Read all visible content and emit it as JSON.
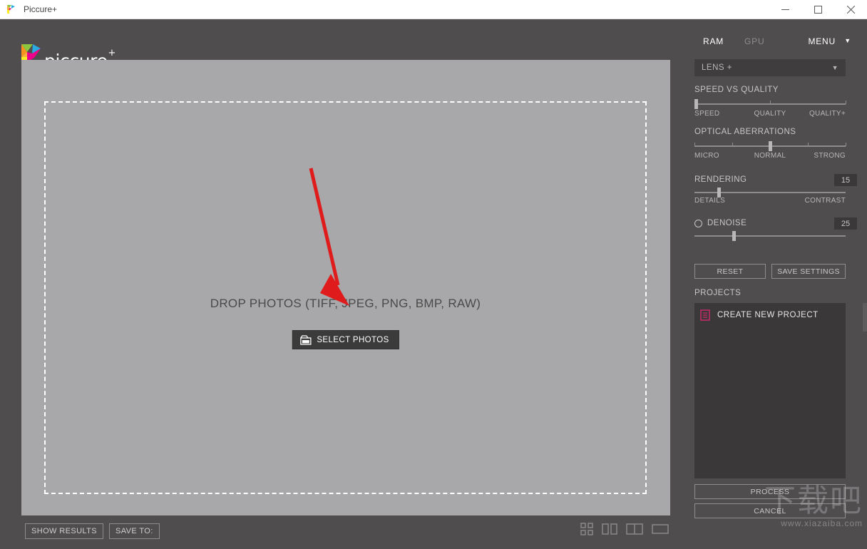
{
  "window": {
    "title": "Piccure+",
    "app_icon": "piccure-logo-icon",
    "controls": {
      "minimize": "minimize-icon",
      "maximize": "maximize-icon",
      "close": "close-icon"
    }
  },
  "brand": {
    "name": "piccure",
    "superscript": "+",
    "mark": "piccure-p-logo"
  },
  "canvas": {
    "drop_text": "DROP PHOTOS (TIFF, JPEG, PNG, BMP, RAW)",
    "select_button": "SELECT PHOTOS",
    "select_button_icon": "photo-folder-icon",
    "background_color": "#a8a8aa"
  },
  "annotation": {
    "type": "red-arrow",
    "color": "#e01b1b"
  },
  "bottom_bar": {
    "show_results": "SHOW RESULTS",
    "save_to": "SAVE TO:",
    "view_modes": [
      {
        "name": "grid-view-icon",
        "label": "grid"
      },
      {
        "name": "two-pane-view-icon",
        "label": "two-pane"
      },
      {
        "name": "split-view-icon",
        "label": "split"
      },
      {
        "name": "single-view-icon",
        "label": "single"
      }
    ]
  },
  "sidebar": {
    "top": {
      "ram": "RAM",
      "gpu": "GPU",
      "menu": "MENU",
      "menu_caret": "chevron-down-icon"
    },
    "lens_select": {
      "value": "LENS +",
      "caret": "chevron-down-icon"
    },
    "speed_vs_quality": {
      "title": "SPEED VS QUALITY",
      "scale": [
        "SPEED",
        "QUALITY",
        "QUALITY+"
      ],
      "handle_percent": 0,
      "ticks": [
        0,
        50,
        100
      ]
    },
    "optical_aberrations": {
      "title": "OPTICAL ABERRATIONS",
      "scale": [
        "MICRO",
        "NORMAL",
        "STRONG"
      ],
      "handle_percent": 50,
      "ticks": [
        0,
        25,
        50,
        75,
        100
      ]
    },
    "rendering": {
      "title": "RENDERING",
      "value": "15",
      "scale": [
        "DETAILS",
        "CONTRAST"
      ],
      "handle_percent": 15
    },
    "denoise": {
      "title": "DENOISE",
      "value": "25",
      "toggle": "radio-unchecked-icon",
      "handle_percent": 25
    },
    "buttons": {
      "reset": "RESET",
      "save_settings": "SAVE SETTINGS"
    },
    "projects": {
      "title": "PROJECTS",
      "create_new": "CREATE NEW PROJECT",
      "create_icon": "new-project-icon",
      "icon_color": "#d4276e"
    },
    "actions": {
      "process": "PROCESS",
      "cancel": "CANCEL"
    }
  },
  "watermark": {
    "chinese": "下载吧",
    "url": "www.xiazaiba.com"
  }
}
